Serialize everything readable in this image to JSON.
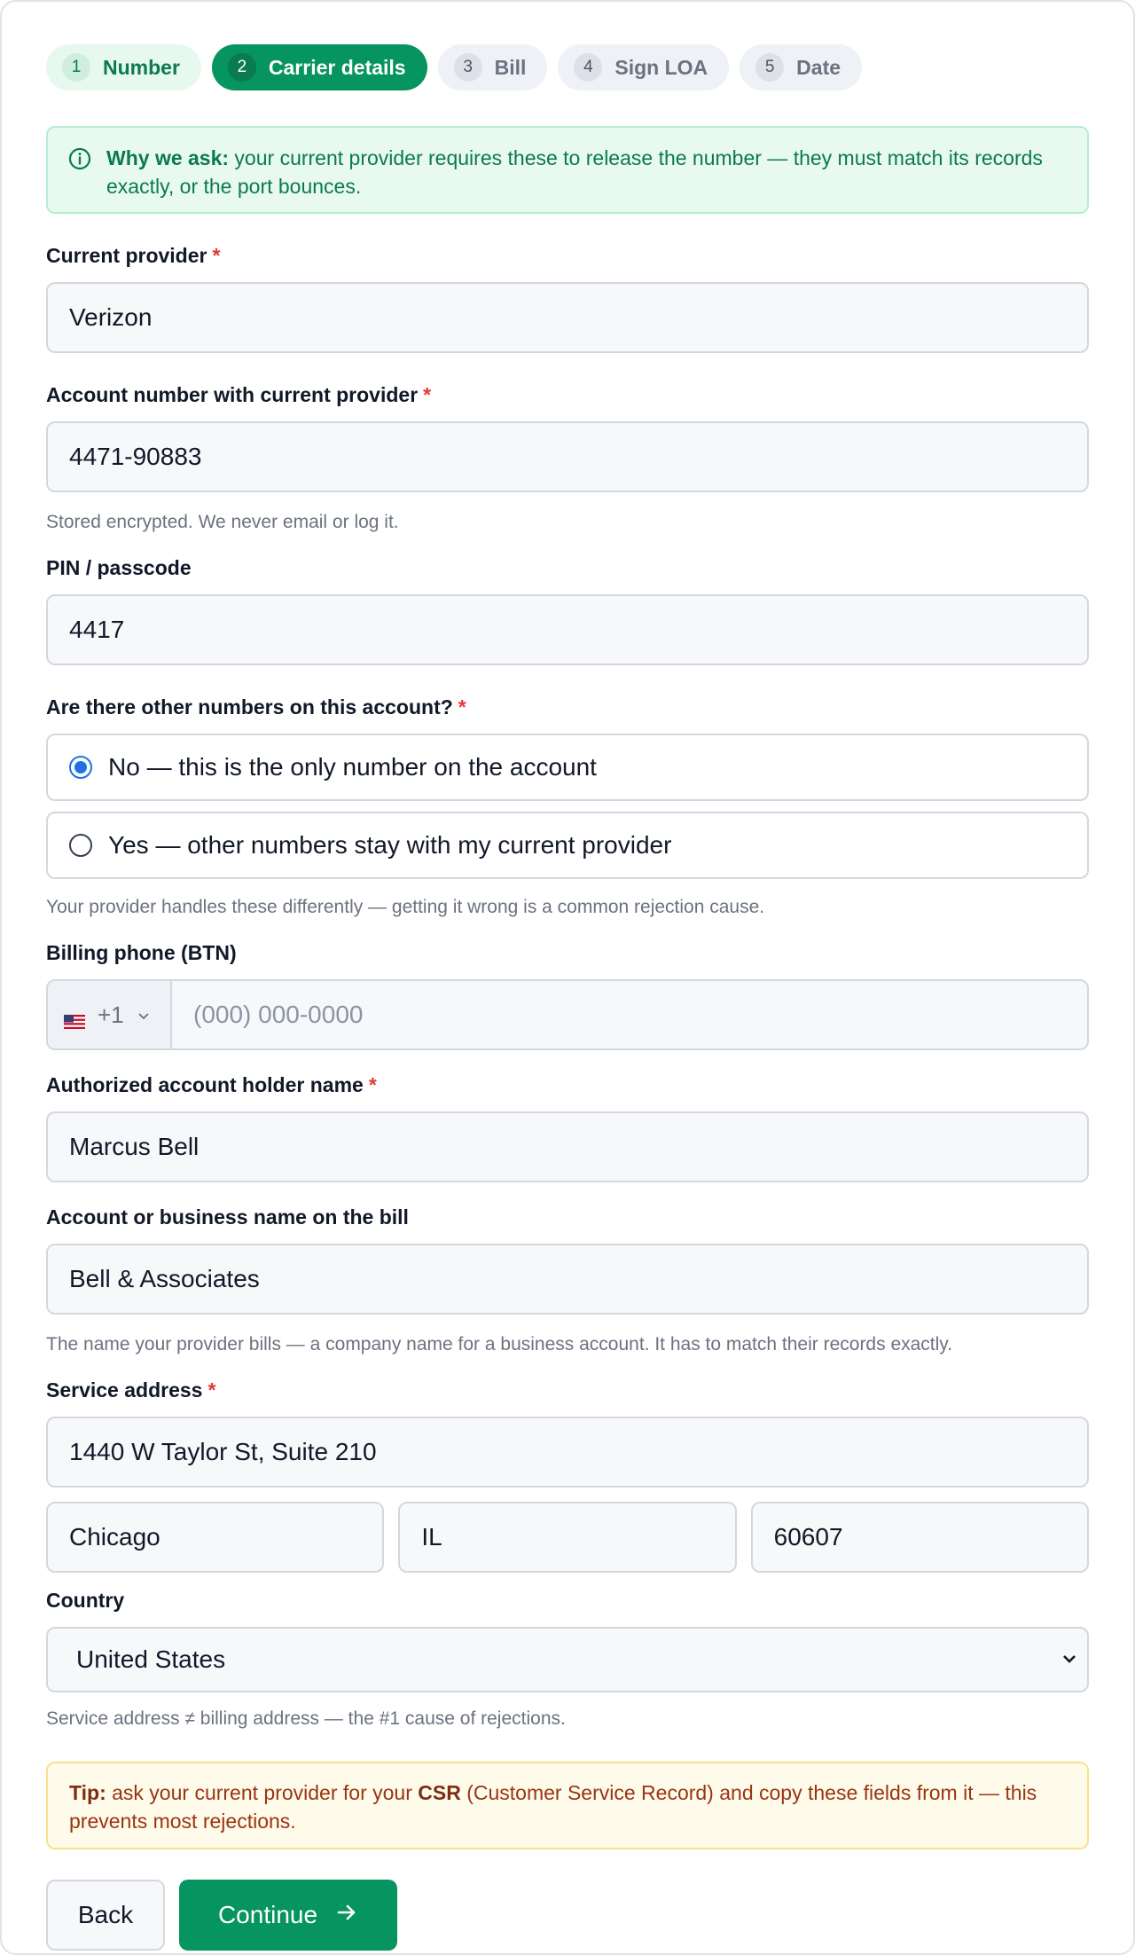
{
  "stepper": [
    {
      "num": "1",
      "label": "Number",
      "state": "done"
    },
    {
      "num": "2",
      "label": "Carrier details",
      "state": "active"
    },
    {
      "num": "3",
      "label": "Bill",
      "state": "upcoming"
    },
    {
      "num": "4",
      "label": "Sign LOA",
      "state": "upcoming"
    },
    {
      "num": "5",
      "label": "Date",
      "state": "upcoming"
    }
  ],
  "info_banner": {
    "icon": "info-icon",
    "lead": "Why we ask:",
    "text": " your current provider requires these to release the number — they must match its records exactly, or the port bounces."
  },
  "fields": {
    "current_provider": {
      "label": "Current provider",
      "value": "Verizon",
      "required": true
    },
    "account_number": {
      "label": "Account number with current provider",
      "value": "4471-90883",
      "required": true,
      "help": "Stored encrypted. We never email or log it."
    },
    "pin": {
      "label": "PIN / passcode",
      "value": "4417"
    },
    "other_numbers": {
      "label": "Are there other numbers on this account?",
      "required": true,
      "options": [
        {
          "label": "No — this is the only number on the account",
          "selected": true
        },
        {
          "label": "Yes — other numbers stay with my current provider",
          "selected": false
        }
      ],
      "help": "Your provider handles these differently — getting it wrong is a common rejection cause."
    },
    "billing_phone": {
      "label": "Billing phone (BTN)",
      "country_code": "+1",
      "placeholder": "(000) 000-0000"
    },
    "account_holder": {
      "label": "Authorized account holder name",
      "value": "Marcus Bell",
      "required": true
    },
    "business_name": {
      "label": "Account or business name on the bill",
      "value": "Bell & Associates",
      "help": "The name your provider bills — a company name for a business account. It has to match their records exactly."
    },
    "service_address": {
      "label": "Service address",
      "required": true,
      "street": "1440 W Taylor St, Suite 210",
      "city": "Chicago",
      "state": "IL",
      "zip": "60607"
    },
    "country": {
      "label": "Country",
      "value": "United States",
      "help": "Service address ≠ billing address — the #1 cause of rejections."
    }
  },
  "tip": {
    "lead": "Tip:",
    "pre": " ask your current provider for your ",
    "bold": "CSR",
    "post": " (Customer Service Record) and copy these fields from it — this prevents most rejections."
  },
  "actions": {
    "back": "Back",
    "continue": "Continue"
  },
  "colors": {
    "accent": "#069461",
    "required": "#e53935",
    "radio": "#1a73e8"
  }
}
